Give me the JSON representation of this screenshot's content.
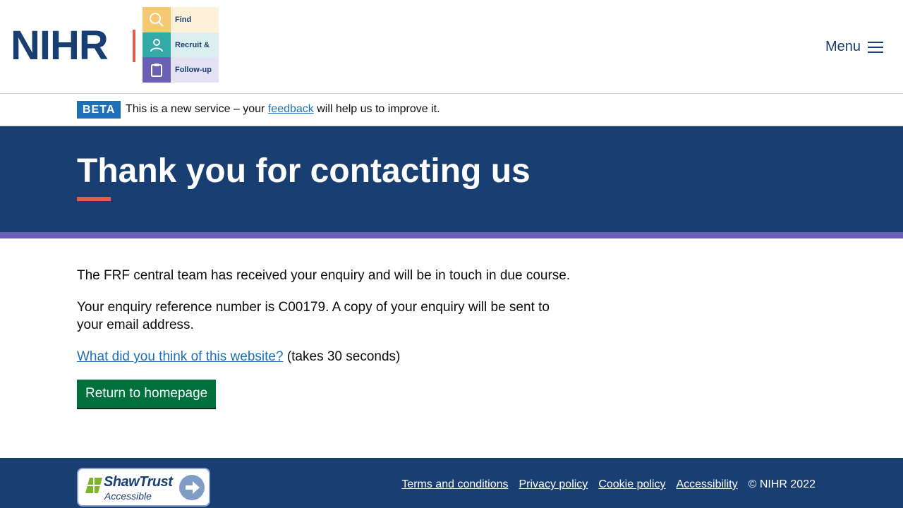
{
  "header": {
    "logo_text": "NIHR",
    "frf_items": [
      "Find",
      "Recruit &",
      "Follow-up"
    ],
    "menu_label": "Menu"
  },
  "beta": {
    "tag": "BETA",
    "text_before": "This is a new service – your ",
    "link": "feedback",
    "text_after": " will help us to improve it."
  },
  "hero": {
    "title": "Thank you for contacting us"
  },
  "main": {
    "para1": "The FRF central team has received your enquiry and will be in touch in due course.",
    "para2": "Your enquiry reference number is C00179. A copy of your enquiry will be sent to your email address.",
    "survey_link": "What did you think of this website?",
    "survey_suffix": " (takes 30 seconds)",
    "button": "Return to homepage"
  },
  "footer": {
    "shaw_name": "ShawTrust",
    "shaw_sub": "Accessible",
    "links": [
      "Terms and conditions",
      "Privacy policy",
      "Cookie policy",
      "Accessibility"
    ],
    "copyright": "© NIHR 2022"
  },
  "colors": {
    "navy": "#193e72",
    "accent_red": "#e05e4e",
    "stripe_purple": "#6b5fb5",
    "link_blue": "#1d70b8",
    "button_green": "#00703c"
  }
}
